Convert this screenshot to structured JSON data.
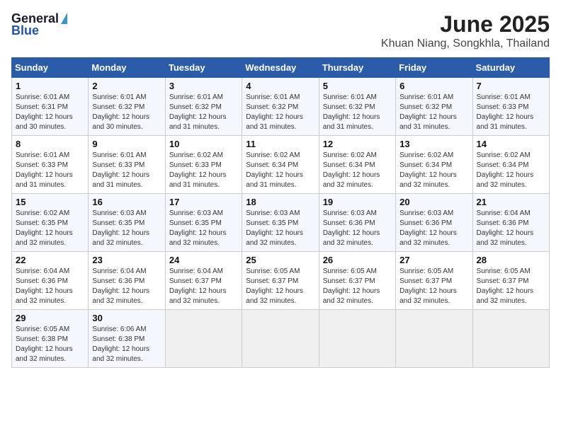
{
  "header": {
    "logo_general": "General",
    "logo_blue": "Blue",
    "month": "June 2025",
    "location": "Khuan Niang, Songkhla, Thailand"
  },
  "weekdays": [
    "Sunday",
    "Monday",
    "Tuesday",
    "Wednesday",
    "Thursday",
    "Friday",
    "Saturday"
  ],
  "weeks": [
    [
      {
        "day": "1",
        "info": "Sunrise: 6:01 AM\nSunset: 6:31 PM\nDaylight: 12 hours\nand 30 minutes."
      },
      {
        "day": "2",
        "info": "Sunrise: 6:01 AM\nSunset: 6:32 PM\nDaylight: 12 hours\nand 30 minutes."
      },
      {
        "day": "3",
        "info": "Sunrise: 6:01 AM\nSunset: 6:32 PM\nDaylight: 12 hours\nand 31 minutes."
      },
      {
        "day": "4",
        "info": "Sunrise: 6:01 AM\nSunset: 6:32 PM\nDaylight: 12 hours\nand 31 minutes."
      },
      {
        "day": "5",
        "info": "Sunrise: 6:01 AM\nSunset: 6:32 PM\nDaylight: 12 hours\nand 31 minutes."
      },
      {
        "day": "6",
        "info": "Sunrise: 6:01 AM\nSunset: 6:32 PM\nDaylight: 12 hours\nand 31 minutes."
      },
      {
        "day": "7",
        "info": "Sunrise: 6:01 AM\nSunset: 6:33 PM\nDaylight: 12 hours\nand 31 minutes."
      }
    ],
    [
      {
        "day": "8",
        "info": "Sunrise: 6:01 AM\nSunset: 6:33 PM\nDaylight: 12 hours\nand 31 minutes."
      },
      {
        "day": "9",
        "info": "Sunrise: 6:01 AM\nSunset: 6:33 PM\nDaylight: 12 hours\nand 31 minutes."
      },
      {
        "day": "10",
        "info": "Sunrise: 6:02 AM\nSunset: 6:33 PM\nDaylight: 12 hours\nand 31 minutes."
      },
      {
        "day": "11",
        "info": "Sunrise: 6:02 AM\nSunset: 6:34 PM\nDaylight: 12 hours\nand 31 minutes."
      },
      {
        "day": "12",
        "info": "Sunrise: 6:02 AM\nSunset: 6:34 PM\nDaylight: 12 hours\nand 32 minutes."
      },
      {
        "day": "13",
        "info": "Sunrise: 6:02 AM\nSunset: 6:34 PM\nDaylight: 12 hours\nand 32 minutes."
      },
      {
        "day": "14",
        "info": "Sunrise: 6:02 AM\nSunset: 6:34 PM\nDaylight: 12 hours\nand 32 minutes."
      }
    ],
    [
      {
        "day": "15",
        "info": "Sunrise: 6:02 AM\nSunset: 6:35 PM\nDaylight: 12 hours\nand 32 minutes."
      },
      {
        "day": "16",
        "info": "Sunrise: 6:03 AM\nSunset: 6:35 PM\nDaylight: 12 hours\nand 32 minutes."
      },
      {
        "day": "17",
        "info": "Sunrise: 6:03 AM\nSunset: 6:35 PM\nDaylight: 12 hours\nand 32 minutes."
      },
      {
        "day": "18",
        "info": "Sunrise: 6:03 AM\nSunset: 6:35 PM\nDaylight: 12 hours\nand 32 minutes."
      },
      {
        "day": "19",
        "info": "Sunrise: 6:03 AM\nSunset: 6:36 PM\nDaylight: 12 hours\nand 32 minutes."
      },
      {
        "day": "20",
        "info": "Sunrise: 6:03 AM\nSunset: 6:36 PM\nDaylight: 12 hours\nand 32 minutes."
      },
      {
        "day": "21",
        "info": "Sunrise: 6:04 AM\nSunset: 6:36 PM\nDaylight: 12 hours\nand 32 minutes."
      }
    ],
    [
      {
        "day": "22",
        "info": "Sunrise: 6:04 AM\nSunset: 6:36 PM\nDaylight: 12 hours\nand 32 minutes."
      },
      {
        "day": "23",
        "info": "Sunrise: 6:04 AM\nSunset: 6:36 PM\nDaylight: 12 hours\nand 32 minutes."
      },
      {
        "day": "24",
        "info": "Sunrise: 6:04 AM\nSunset: 6:37 PM\nDaylight: 12 hours\nand 32 minutes."
      },
      {
        "day": "25",
        "info": "Sunrise: 6:05 AM\nSunset: 6:37 PM\nDaylight: 12 hours\nand 32 minutes."
      },
      {
        "day": "26",
        "info": "Sunrise: 6:05 AM\nSunset: 6:37 PM\nDaylight: 12 hours\nand 32 minutes."
      },
      {
        "day": "27",
        "info": "Sunrise: 6:05 AM\nSunset: 6:37 PM\nDaylight: 12 hours\nand 32 minutes."
      },
      {
        "day": "28",
        "info": "Sunrise: 6:05 AM\nSunset: 6:37 PM\nDaylight: 12 hours\nand 32 minutes."
      }
    ],
    [
      {
        "day": "29",
        "info": "Sunrise: 6:05 AM\nSunset: 6:38 PM\nDaylight: 12 hours\nand 32 minutes."
      },
      {
        "day": "30",
        "info": "Sunrise: 6:06 AM\nSunset: 6:38 PM\nDaylight: 12 hours\nand 32 minutes."
      },
      null,
      null,
      null,
      null,
      null
    ]
  ]
}
